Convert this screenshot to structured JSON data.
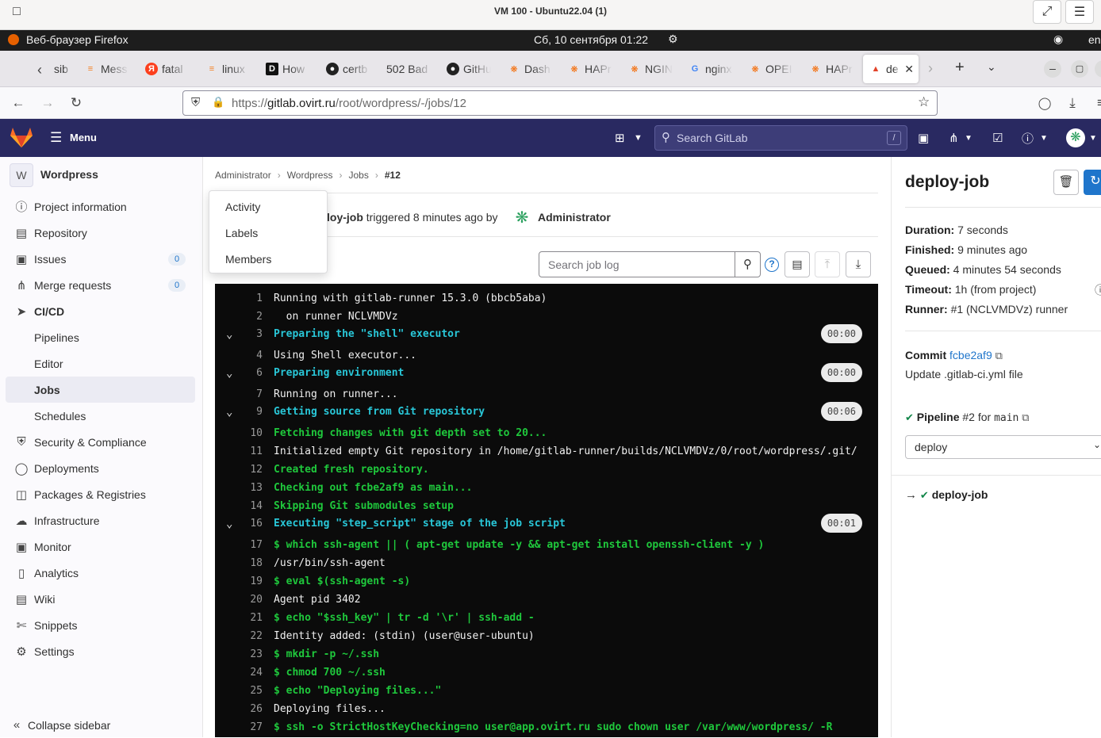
{
  "vm": {
    "title": "VM 100 - Ubuntu22.04 (1)"
  },
  "panel": {
    "browser": "Веб-браузер Firefox",
    "datetime": "Сб, 10 сентября  01:22",
    "lang": "en"
  },
  "tabs": [
    {
      "label": "sib",
      "icon": "stack-icon"
    },
    {
      "label": "Mess",
      "icon": "stack-icon"
    },
    {
      "label": "fatal",
      "icon": "yandex-icon"
    },
    {
      "label": "linux",
      "icon": "stack-icon"
    },
    {
      "label": "How",
      "icon": "dev-icon"
    },
    {
      "label": "certb",
      "icon": "github-icon"
    },
    {
      "label": "502 Bad",
      "icon": "none"
    },
    {
      "label": "GitHu",
      "icon": "github-icon"
    },
    {
      "label": "Dash",
      "icon": "grafana-icon"
    },
    {
      "label": "HAPr",
      "icon": "grafana-icon"
    },
    {
      "label": "NGIN",
      "icon": "grafana-icon"
    },
    {
      "label": "nginx",
      "icon": "google-icon"
    },
    {
      "label": "OPEI",
      "icon": "grafana-icon"
    },
    {
      "label": "HAPr",
      "icon": "grafana-icon"
    },
    {
      "label": "de",
      "icon": "gitlab-icon"
    }
  ],
  "url": {
    "scheme": "https://",
    "host": "gitlab.ovirt.ru",
    "path": "/root/wordpress/-/jobs/12"
  },
  "gitlab": {
    "menu": "Menu",
    "search_placeholder": "Search GitLab",
    "search_kbd": "/"
  },
  "sidebar": {
    "project_initial": "W",
    "project_name": "Wordpress",
    "items": [
      {
        "label": "Project information",
        "icon": "info-icon"
      },
      {
        "label": "Repository",
        "icon": "doc-icon"
      },
      {
        "label": "Issues",
        "icon": "issues-icon",
        "badge": "0"
      },
      {
        "label": "Merge requests",
        "icon": "merge-icon",
        "badge": "0"
      },
      {
        "label": "CI/CD",
        "icon": "rocket-icon"
      },
      {
        "label": "Pipelines"
      },
      {
        "label": "Editor"
      },
      {
        "label": "Jobs"
      },
      {
        "label": "Schedules"
      },
      {
        "label": "Security & Compliance",
        "icon": "shield-icon"
      },
      {
        "label": "Deployments",
        "icon": "deploy-icon"
      },
      {
        "label": "Packages & Registries",
        "icon": "package-icon"
      },
      {
        "label": "Infrastructure",
        "icon": "cloud-icon"
      },
      {
        "label": "Monitor",
        "icon": "monitor-icon"
      },
      {
        "label": "Analytics",
        "icon": "chart-icon"
      },
      {
        "label": "Wiki",
        "icon": "book-icon"
      },
      {
        "label": "Snippets",
        "icon": "scissors-icon"
      },
      {
        "label": "Settings",
        "icon": "gear-icon"
      }
    ],
    "collapse": "Collapse sidebar"
  },
  "breadcrumb": [
    "Administrator",
    "Wordpress",
    "Jobs",
    "#12"
  ],
  "popup": [
    "Activity",
    "Labels",
    "Members"
  ],
  "job_header": {
    "name_partial": "loy-job",
    "triggered": "triggered 8 minutes ago by",
    "user": "Administrator"
  },
  "log_search_placeholder": "Search job log",
  "log": [
    {
      "n": "1",
      "text": "Running with gitlab-runner 15.3.0 (bbcb5aba)",
      "c": "w"
    },
    {
      "n": "2",
      "text": "  on runner NCLVMDVz",
      "c": "w"
    },
    {
      "n": "3",
      "text": "Preparing the \"shell\" executor",
      "c": "c",
      "chev": true,
      "dur": "00:00"
    },
    {
      "n": "4",
      "text": "Using Shell executor...",
      "c": "w"
    },
    {
      "n": "6",
      "text": "Preparing environment",
      "c": "c",
      "chev": true,
      "dur": "00:00"
    },
    {
      "n": "7",
      "text": "Running on runner...",
      "c": "w"
    },
    {
      "n": "9",
      "text": "Getting source from Git repository",
      "c": "c",
      "chev": true,
      "dur": "00:06"
    },
    {
      "n": "10",
      "text": "Fetching changes with git depth set to 20...",
      "c": "g"
    },
    {
      "n": "11",
      "text": "Initialized empty Git repository in /home/gitlab-runner/builds/NCLVMDVz/0/root/wordpress/.git/",
      "c": "w"
    },
    {
      "n": "12",
      "text": "Created fresh repository.",
      "c": "g"
    },
    {
      "n": "13",
      "text": "Checking out fcbe2af9 as main...",
      "c": "g"
    },
    {
      "n": "14",
      "text": "Skipping Git submodules setup",
      "c": "g"
    },
    {
      "n": "16",
      "text": "Executing \"step_script\" stage of the job script",
      "c": "c",
      "chev": true,
      "dur": "00:01"
    },
    {
      "n": "17",
      "text": "$ which ssh-agent || ( apt-get update -y && apt-get install openssh-client -y )",
      "c": "g"
    },
    {
      "n": "18",
      "text": "/usr/bin/ssh-agent",
      "c": "w"
    },
    {
      "n": "19",
      "text": "$ eval $(ssh-agent -s)",
      "c": "g"
    },
    {
      "n": "20",
      "text": "Agent pid 3402",
      "c": "w"
    },
    {
      "n": "21",
      "text": "$ echo \"$ssh_key\" | tr -d '\\r' | ssh-add -",
      "c": "g"
    },
    {
      "n": "22",
      "text": "Identity added: (stdin) (user@user-ubuntu)",
      "c": "w"
    },
    {
      "n": "23",
      "text": "$ mkdir -p ~/.ssh",
      "c": "g"
    },
    {
      "n": "24",
      "text": "$ chmod 700 ~/.ssh",
      "c": "g"
    },
    {
      "n": "25",
      "text": "$ echo \"Deploying files...\"",
      "c": "g"
    },
    {
      "n": "26",
      "text": "Deploying files...",
      "c": "w"
    },
    {
      "n": "27",
      "text": "$ ssh -o StrictHostKeyChecking=no user@app.ovirt.ru sudo chown user /var/www/wordpress/ -R",
      "c": "g"
    }
  ],
  "right": {
    "title": "deploy-job",
    "duration_label": "Duration:",
    "duration": "7 seconds",
    "finished_label": "Finished:",
    "finished": "9 minutes ago",
    "queued_label": "Queued:",
    "queued": "4 minutes 54 seconds",
    "timeout_label": "Timeout:",
    "timeout": "1h (from project)",
    "runner_label": "Runner:",
    "runner": "#1 (NCLVMDVz) runner",
    "commit_label": "Commit",
    "commit_sha": "fcbe2af9",
    "commit_msg": "Update .gitlab-ci.yml file",
    "pipeline_label": "Pipeline",
    "pipeline_id": "#2",
    "pipeline_for": "for",
    "pipeline_branch": "main",
    "stage": "deploy",
    "job": "deploy-job"
  },
  "colors": {
    "gitlab_header": "#292961",
    "success": "#108548",
    "log_bg": "#0b0b0b",
    "link": "#1f75cb"
  }
}
